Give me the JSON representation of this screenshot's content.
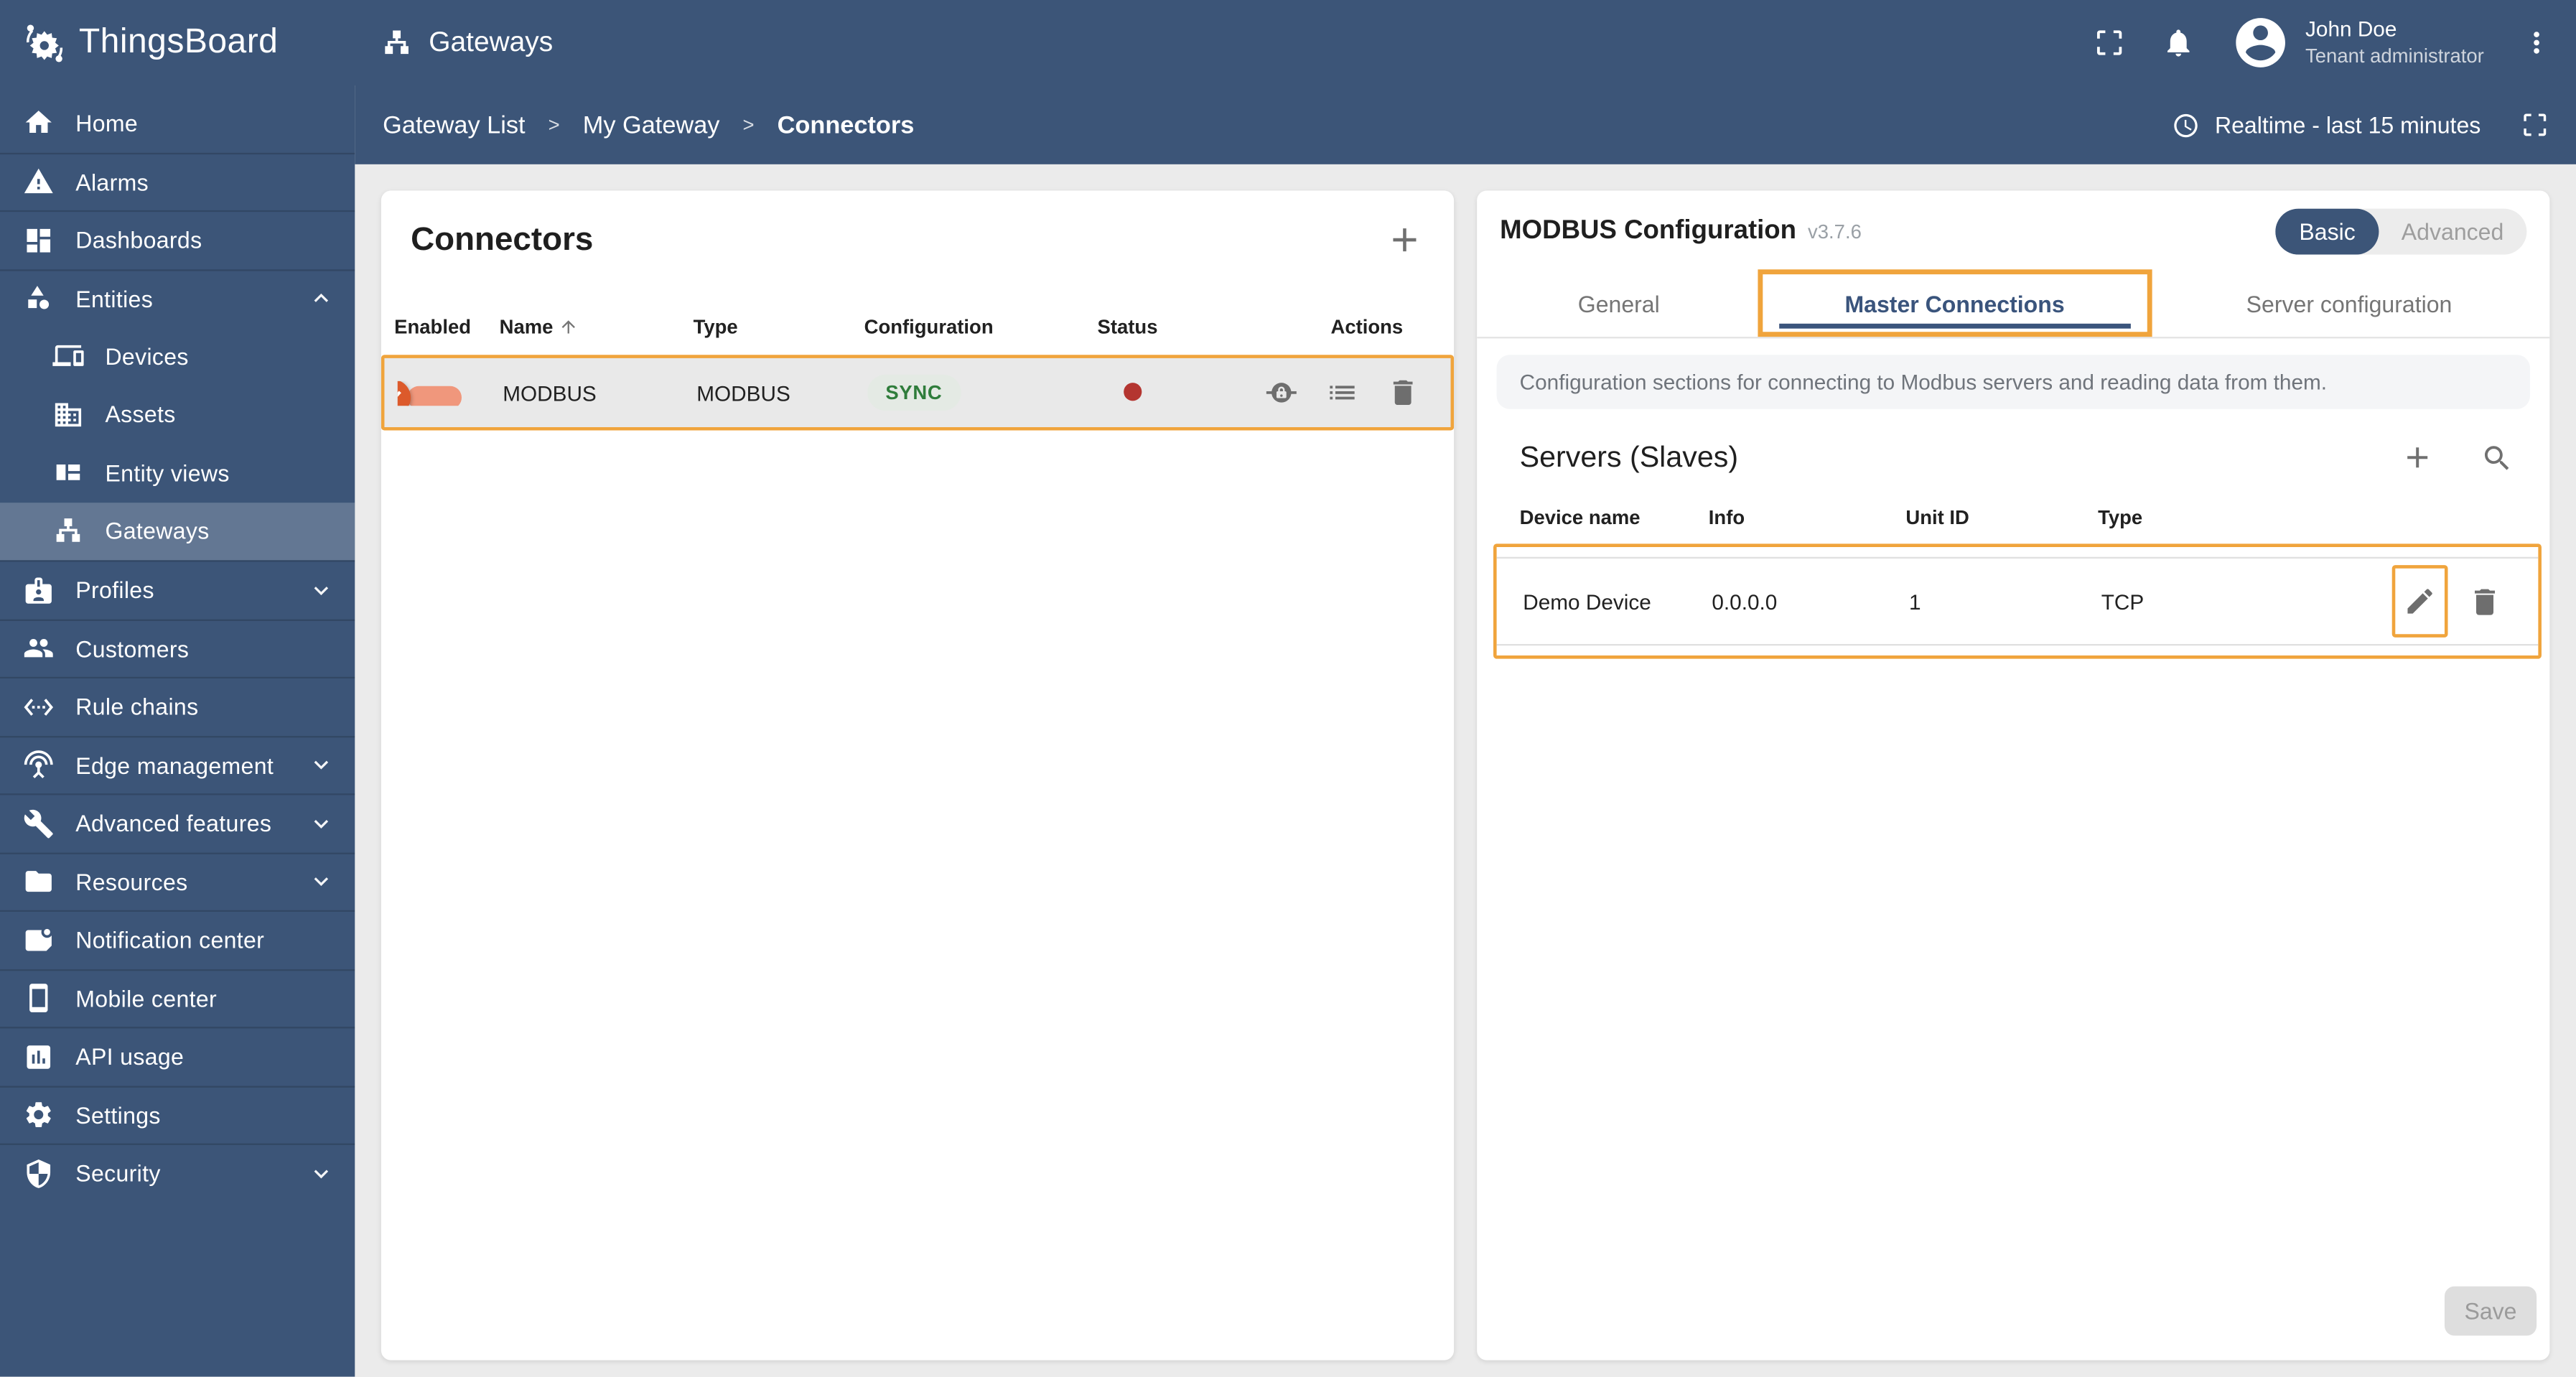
{
  "header": {
    "brand": "ThingsBoard",
    "page_title": "Gateways",
    "user": {
      "name": "John Doe",
      "role": "Tenant administrator"
    }
  },
  "breadcrumb": {
    "items": [
      "Gateway List",
      "My Gateway",
      "Connectors"
    ],
    "separator": ">"
  },
  "toolbar": {
    "timewindow": "Realtime - last 15 minutes"
  },
  "sidebar": {
    "items": [
      {
        "label": "Home"
      },
      {
        "label": "Alarms"
      },
      {
        "label": "Dashboards"
      },
      {
        "label": "Entities",
        "expanded": true
      },
      {
        "label": "Devices",
        "child": true
      },
      {
        "label": "Assets",
        "child": true
      },
      {
        "label": "Entity views",
        "child": true
      },
      {
        "label": "Gateways",
        "child": true,
        "selected": true
      },
      {
        "label": "Profiles"
      },
      {
        "label": "Customers"
      },
      {
        "label": "Rule chains"
      },
      {
        "label": "Edge management"
      },
      {
        "label": "Advanced features"
      },
      {
        "label": "Resources"
      },
      {
        "label": "Notification center"
      },
      {
        "label": "Mobile center"
      },
      {
        "label": "API usage"
      },
      {
        "label": "Settings"
      },
      {
        "label": "Security"
      }
    ]
  },
  "connectors": {
    "title": "Connectors",
    "columns": [
      "Enabled",
      "Name",
      "Type",
      "Configuration",
      "Status",
      "Actions"
    ],
    "row": {
      "enabled": true,
      "name": "MODBUS",
      "type": "MODBUS",
      "configuration": "SYNC",
      "status": "error"
    }
  },
  "modbus": {
    "title": "MODBUS Configuration",
    "version": "v3.7.6",
    "modes": [
      "Basic",
      "Advanced"
    ],
    "active_mode": "Basic",
    "tabs": [
      "General",
      "Master Connections",
      "Server configuration"
    ],
    "active_tab": "Master Connections",
    "info": "Configuration sections for connecting to Modbus servers and reading data from them.",
    "servers": {
      "title": "Servers (Slaves)",
      "columns": [
        "Device name",
        "Info",
        "Unit ID",
        "Type"
      ],
      "row": {
        "device_name": "Demo Device",
        "info": "0.0.0.0",
        "unit_id": "1",
        "type": "TCP"
      }
    },
    "save_label": "Save"
  },
  "colors": {
    "primary_blue": "#3c5578",
    "accent_orange": "#f0a43c",
    "sync_green": "#2f7d3b",
    "sync_bg": "#e4eae4",
    "status_error_red": "#b43530",
    "toggle_thumb": "#dc5a2b",
    "toggle_track": "#f0977c"
  }
}
